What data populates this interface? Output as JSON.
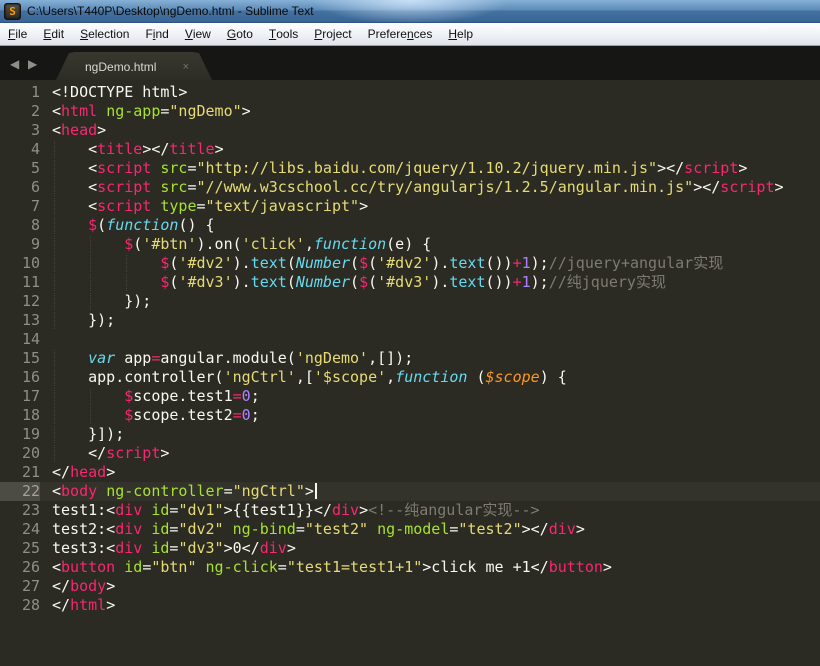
{
  "window": {
    "title": "C:\\Users\\T440P\\Desktop\\ngDemo.html - Sublime Text",
    "icon_letter": "S"
  },
  "menu": {
    "items": [
      {
        "label": "File",
        "accel": 0
      },
      {
        "label": "Edit",
        "accel": 0
      },
      {
        "label": "Selection",
        "accel": 0
      },
      {
        "label": "Find",
        "accel": 1
      },
      {
        "label": "View",
        "accel": 0
      },
      {
        "label": "Goto",
        "accel": 0
      },
      {
        "label": "Tools",
        "accel": 0
      },
      {
        "label": "Project",
        "accel": 0
      },
      {
        "label": "Preferences",
        "accel": 7
      },
      {
        "label": "Help",
        "accel": 0
      }
    ]
  },
  "tab_bar": {
    "back_icon": "◀",
    "forward_icon": "▶",
    "tabs": [
      {
        "label": "ngDemo.html",
        "close_icon": "×",
        "active": true
      }
    ]
  },
  "editor": {
    "active_line": 22,
    "caret_line": 22,
    "lines": [
      {
        "n": 1,
        "t": [
          [
            "w",
            "<!DOCTYPE html>"
          ]
        ]
      },
      {
        "n": 2,
        "t": [
          [
            "w",
            "<"
          ],
          [
            "p",
            "html"
          ],
          [
            "w",
            " "
          ],
          [
            "g",
            "ng-app"
          ],
          [
            "w",
            "="
          ],
          [
            "y",
            "\"ngDemo\""
          ],
          [
            "w",
            ">"
          ]
        ]
      },
      {
        "n": 3,
        "t": [
          [
            "w",
            "<"
          ],
          [
            "p",
            "head"
          ],
          [
            "w",
            ">"
          ]
        ]
      },
      {
        "n": 4,
        "t": [
          [
            "w",
            "    <"
          ],
          [
            "p",
            "title"
          ],
          [
            "w",
            "></"
          ],
          [
            "p",
            "title"
          ],
          [
            "w",
            ">"
          ]
        ]
      },
      {
        "n": 5,
        "t": [
          [
            "w",
            "    <"
          ],
          [
            "p",
            "script"
          ],
          [
            "w",
            " "
          ],
          [
            "g",
            "src"
          ],
          [
            "w",
            "="
          ],
          [
            "y",
            "\"http://libs.baidu.com/jquery/1.10.2/jquery.min.js\""
          ],
          [
            "w",
            "></"
          ],
          [
            "p",
            "script"
          ],
          [
            "w",
            ">"
          ]
        ]
      },
      {
        "n": 6,
        "t": [
          [
            "w",
            "    <"
          ],
          [
            "p",
            "script"
          ],
          [
            "w",
            " "
          ],
          [
            "g",
            "src"
          ],
          [
            "w",
            "="
          ],
          [
            "y",
            "\"//www.w3cschool.cc/try/angularjs/1.2.5/angular.min.js\""
          ],
          [
            "w",
            "></"
          ],
          [
            "p",
            "script"
          ],
          [
            "w",
            ">"
          ]
        ]
      },
      {
        "n": 7,
        "t": [
          [
            "w",
            "    <"
          ],
          [
            "p",
            "script"
          ],
          [
            "w",
            " "
          ],
          [
            "g",
            "type"
          ],
          [
            "w",
            "="
          ],
          [
            "y",
            "\"text/javascript\""
          ],
          [
            "w",
            ">"
          ]
        ]
      },
      {
        "n": 8,
        "t": [
          [
            "w",
            "    "
          ],
          [
            "p",
            "$"
          ],
          [
            "w",
            "("
          ],
          [
            "ci",
            "function"
          ],
          [
            "w",
            "() {"
          ]
        ]
      },
      {
        "n": 9,
        "t": [
          [
            "w",
            "        "
          ],
          [
            "p",
            "$"
          ],
          [
            "w",
            "("
          ],
          [
            "y",
            "'#btn'"
          ],
          [
            "w",
            ").on("
          ],
          [
            "y",
            "'click'"
          ],
          [
            "w",
            ","
          ],
          [
            "ci",
            "function"
          ],
          [
            "w",
            "(e) {"
          ]
        ]
      },
      {
        "n": 10,
        "t": [
          [
            "w",
            "            "
          ],
          [
            "p",
            "$"
          ],
          [
            "w",
            "("
          ],
          [
            "y",
            "'#dv2'"
          ],
          [
            "w",
            ")."
          ],
          [
            "c",
            "text"
          ],
          [
            "w",
            "("
          ],
          [
            "ci",
            "Number"
          ],
          [
            "w",
            "("
          ],
          [
            "p",
            "$"
          ],
          [
            "w",
            "("
          ],
          [
            "y",
            "'#dv2'"
          ],
          [
            "w",
            ")."
          ],
          [
            "c",
            "text"
          ],
          [
            "w",
            "())"
          ],
          [
            "p",
            "+"
          ],
          [
            "v",
            "1"
          ],
          [
            "w",
            ");"
          ],
          [
            "cm",
            "//jquery+angular实现"
          ]
        ]
      },
      {
        "n": 11,
        "t": [
          [
            "w",
            "            "
          ],
          [
            "p",
            "$"
          ],
          [
            "w",
            "("
          ],
          [
            "y",
            "'#dv3'"
          ],
          [
            "w",
            ")."
          ],
          [
            "c",
            "text"
          ],
          [
            "w",
            "("
          ],
          [
            "ci",
            "Number"
          ],
          [
            "w",
            "("
          ],
          [
            "p",
            "$"
          ],
          [
            "w",
            "("
          ],
          [
            "y",
            "'#dv3'"
          ],
          [
            "w",
            ")."
          ],
          [
            "c",
            "text"
          ],
          [
            "w",
            "())"
          ],
          [
            "p",
            "+"
          ],
          [
            "v",
            "1"
          ],
          [
            "w",
            ");"
          ],
          [
            "cm",
            "//纯jquery实现"
          ]
        ]
      },
      {
        "n": 12,
        "t": [
          [
            "w",
            "        });"
          ]
        ]
      },
      {
        "n": 13,
        "t": [
          [
            "w",
            "    });"
          ]
        ]
      },
      {
        "n": 14,
        "t": []
      },
      {
        "n": 15,
        "t": [
          [
            "w",
            "    "
          ],
          [
            "ci",
            "var"
          ],
          [
            "w",
            " app"
          ],
          [
            "p",
            "="
          ],
          [
            "w",
            "angular.module("
          ],
          [
            "y",
            "'ngDemo'"
          ],
          [
            "w",
            ",[]);"
          ]
        ]
      },
      {
        "n": 16,
        "t": [
          [
            "w",
            "    app.controller("
          ],
          [
            "y",
            "'ngCtrl'"
          ],
          [
            "w",
            ",["
          ],
          [
            "y",
            "'$scope'"
          ],
          [
            "w",
            ","
          ],
          [
            "ci",
            "function"
          ],
          [
            "w",
            " ("
          ],
          [
            "o",
            "$scope"
          ],
          [
            "w",
            ") {"
          ]
        ]
      },
      {
        "n": 17,
        "t": [
          [
            "w",
            "        "
          ],
          [
            "p",
            "$"
          ],
          [
            "w",
            "scope.test1"
          ],
          [
            "p",
            "="
          ],
          [
            "v",
            "0"
          ],
          [
            "w",
            ";"
          ]
        ]
      },
      {
        "n": 18,
        "t": [
          [
            "w",
            "        "
          ],
          [
            "p",
            "$"
          ],
          [
            "w",
            "scope.test2"
          ],
          [
            "p",
            "="
          ],
          [
            "v",
            "0"
          ],
          [
            "w",
            ";"
          ]
        ]
      },
      {
        "n": 19,
        "t": [
          [
            "w",
            "    }]);"
          ]
        ]
      },
      {
        "n": 20,
        "t": [
          [
            "w",
            "    </"
          ],
          [
            "p",
            "script"
          ],
          [
            "w",
            ">"
          ]
        ]
      },
      {
        "n": 21,
        "t": [
          [
            "w",
            "</"
          ],
          [
            "p",
            "head"
          ],
          [
            "w",
            ">"
          ]
        ]
      },
      {
        "n": 22,
        "t": [
          [
            "w",
            "<"
          ],
          [
            "p",
            "body"
          ],
          [
            "w",
            " "
          ],
          [
            "g",
            "ng-controller"
          ],
          [
            "w",
            "="
          ],
          [
            "y",
            "\"ngCtrl\""
          ],
          [
            "w",
            ">"
          ]
        ]
      },
      {
        "n": 23,
        "t": [
          [
            "w",
            "test1:<"
          ],
          [
            "p",
            "div"
          ],
          [
            "w",
            " "
          ],
          [
            "g",
            "id"
          ],
          [
            "w",
            "="
          ],
          [
            "y",
            "\"dv1\""
          ],
          [
            "w",
            ">{{test1}}</"
          ],
          [
            "p",
            "div"
          ],
          [
            "w",
            ">"
          ],
          [
            "cm",
            "<!--纯angular实现-->"
          ]
        ]
      },
      {
        "n": 24,
        "t": [
          [
            "w",
            "test2:<"
          ],
          [
            "p",
            "div"
          ],
          [
            "w",
            " "
          ],
          [
            "g",
            "id"
          ],
          [
            "w",
            "="
          ],
          [
            "y",
            "\"dv2\""
          ],
          [
            "w",
            " "
          ],
          [
            "g",
            "ng-bind"
          ],
          [
            "w",
            "="
          ],
          [
            "y",
            "\"test2\""
          ],
          [
            "w",
            " "
          ],
          [
            "g",
            "ng-model"
          ],
          [
            "w",
            "="
          ],
          [
            "y",
            "\"test2\""
          ],
          [
            "w",
            "></"
          ],
          [
            "p",
            "div"
          ],
          [
            "w",
            ">"
          ]
        ]
      },
      {
        "n": 25,
        "t": [
          [
            "w",
            "test3:<"
          ],
          [
            "p",
            "div"
          ],
          [
            "w",
            " "
          ],
          [
            "g",
            "id"
          ],
          [
            "w",
            "="
          ],
          [
            "y",
            "\"dv3\""
          ],
          [
            "w",
            ">0</"
          ],
          [
            "p",
            "div"
          ],
          [
            "w",
            ">"
          ]
        ]
      },
      {
        "n": 26,
        "t": [
          [
            "w",
            "<"
          ],
          [
            "p",
            "button"
          ],
          [
            "w",
            " "
          ],
          [
            "g",
            "id"
          ],
          [
            "w",
            "="
          ],
          [
            "y",
            "\"btn\""
          ],
          [
            "w",
            " "
          ],
          [
            "g",
            "ng-click"
          ],
          [
            "w",
            "="
          ],
          [
            "y",
            "\"test1=test1+1\""
          ],
          [
            "w",
            ">click me +1</"
          ],
          [
            "p",
            "button"
          ],
          [
            "w",
            ">"
          ]
        ]
      },
      {
        "n": 27,
        "t": [
          [
            "w",
            "</"
          ],
          [
            "p",
            "body"
          ],
          [
            "w",
            ">"
          ]
        ]
      },
      {
        "n": 28,
        "t": [
          [
            "w",
            "</"
          ],
          [
            "p",
            "html"
          ],
          [
            "w",
            ">"
          ]
        ]
      }
    ]
  },
  "colors": {
    "bg": "#2b2b23",
    "fg": "#f8f8f2",
    "pink": "#f92672",
    "green": "#a6e22e",
    "yellow": "#e6db74",
    "cyan": "#66d9ef",
    "purple": "#ae81ff",
    "orange": "#fd971f",
    "comment": "#7e7c71",
    "gutter": "#8f8f84",
    "gutterActive": "#4c4c45",
    "lineActive": "#33332b"
  }
}
